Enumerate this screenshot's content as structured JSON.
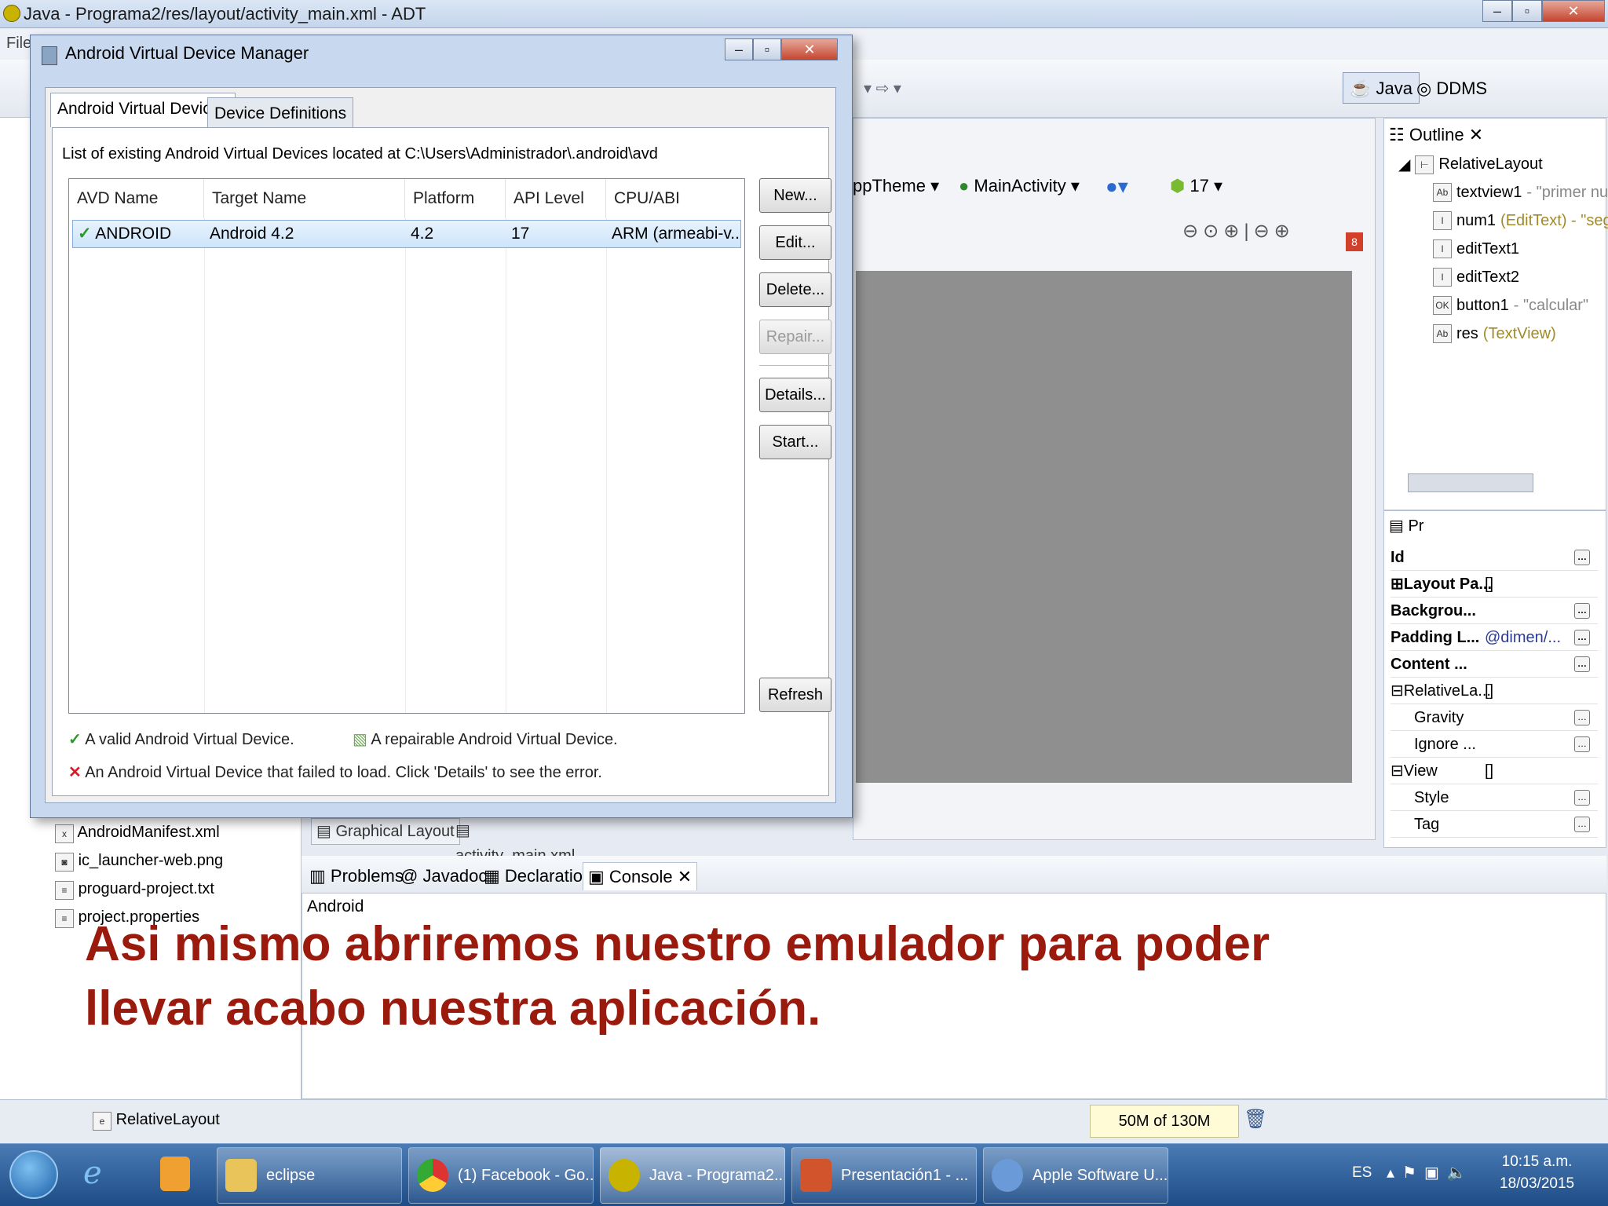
{
  "window": {
    "title": "Java - Programa2/res/layout/activity_main.xml - ADT"
  },
  "menu": {
    "file": "File"
  },
  "perspectives": {
    "java": "Java",
    "ddms": "DDMS"
  },
  "editor": {
    "theme": "ppTheme",
    "activity": "MainActivity",
    "api": "17",
    "error_count": "8"
  },
  "outline": {
    "title": "Outline",
    "items": [
      {
        "label": "RelativeLayout",
        "extra": ""
      },
      {
        "label": "textview1",
        "extra": " - \"primer nur"
      },
      {
        "label": "num1",
        "extra": " (EditText) - \"segu"
      },
      {
        "label": "editText1",
        "extra": ""
      },
      {
        "label": "editText2",
        "extra": ""
      },
      {
        "label": "button1",
        "extra": " - \"calcular\""
      },
      {
        "label": "res",
        "extra": " (TextView)"
      }
    ]
  },
  "properties": {
    "tab": "Pr",
    "rows": [
      {
        "name": "Id",
        "value": ""
      },
      {
        "name": "Layout Pa...",
        "value": "[]"
      },
      {
        "name": "Backgrou...",
        "value": ""
      },
      {
        "name": "Padding L...",
        "value": "@dimen/..."
      },
      {
        "name": "Content ...",
        "value": ""
      },
      {
        "name": "RelativeLa...",
        "value": "[]"
      },
      {
        "name": "Gravity",
        "value": ""
      },
      {
        "name": "Ignore ...",
        "value": ""
      },
      {
        "name": "View",
        "value": "[]"
      },
      {
        "name": "Style",
        "value": ""
      },
      {
        "name": "Tag",
        "value": ""
      }
    ]
  },
  "package_explorer": {
    "files": [
      "AndroidManifest.xml",
      "ic_launcher-web.png",
      "proguard-project.txt",
      "project.properties"
    ]
  },
  "editor_tabs": {
    "graphical": "Graphical Layout",
    "xml": "activity_main.xml"
  },
  "bottom_tabs": {
    "problems": "Problems",
    "javadoc": "Javadoc",
    "declaration": "Declaration",
    "console": "Console"
  },
  "console": {
    "label": "Android"
  },
  "status": {
    "selection": "RelativeLayout",
    "memory": "50M of 130M"
  },
  "dialog": {
    "title": "Android Virtual Device Manager",
    "tabs": [
      "Android Virtual Devices",
      "Device Definitions"
    ],
    "location_text": "List of existing Android Virtual Devices located at C:\\Users\\Administrador\\.android\\avd",
    "columns": [
      "AVD Name",
      "Target Name",
      "Platform",
      "API Level",
      "CPU/ABI"
    ],
    "rows": [
      {
        "name": "ANDROID",
        "target": "Android 4.2",
        "platform": "4.2",
        "api": "17",
        "cpu": "ARM (armeabi-v..."
      }
    ],
    "buttons": {
      "new": "New...",
      "edit": "Edit...",
      "delete": "Delete...",
      "repair": "Repair...",
      "details": "Details...",
      "start": "Start...",
      "refresh": "Refresh"
    },
    "legend": {
      "valid": "A valid Android Virtual Device.",
      "repairable": "A repairable Android Virtual Device.",
      "failed": "An Android Virtual Device that failed to load. Click 'Details' to see the error."
    }
  },
  "overlay": {
    "line1": "Asi mismo abriremos nuestro emulador para poder",
    "line2": "llevar acabo nuestra aplicación."
  },
  "taskbar": {
    "items": [
      "eclipse",
      "(1) Facebook - Go...",
      "Java - Programa2...",
      "Presentación1 - ...",
      "Apple Software U..."
    ],
    "lang": "ES",
    "time": "10:15 a.m.",
    "date": "18/03/2015"
  },
  "colors": {
    "accent": "#9a1a0e",
    "taskbar": "#1e4c86",
    "canvas": "#8f8f8f"
  }
}
